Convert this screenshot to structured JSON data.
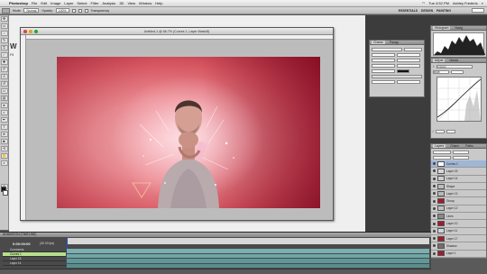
{
  "menubar": {
    "app_name": "Photoshop",
    "items": [
      "File",
      "Edit",
      "Image",
      "Layer",
      "Select",
      "Filter",
      "Analysis",
      "3D",
      "View",
      "Window",
      "Help"
    ],
    "clock": "Tue 4:52 PM",
    "user": "Ashley Frederic"
  },
  "options": {
    "mode_label": "Mode:",
    "mode_value": "Normal",
    "opacity_label": "Opacity:",
    "opacity_value": "100%",
    "transparency_label": "Transparency",
    "workspaces": [
      "ESSENTIALS",
      "DESIGN",
      "PAINTING"
    ]
  },
  "document": {
    "title": "Untitled-1 @ 66.7% (Curves 1, Layer Mask/8)"
  },
  "background_page": {
    "heading": "W",
    "sub": "Fil"
  },
  "panels": {
    "character_tabs": [
      "Charac",
      "Paragr"
    ],
    "histogram_tabs": [
      "Histogram",
      "Navig"
    ],
    "adjust_tabs": [
      "Adjust",
      "Masks"
    ],
    "adjust_preset": "Custom",
    "adjust_channel": "RGB",
    "layers_tabs": [
      "Layers",
      "Chann",
      "Paths"
    ],
    "layers": [
      {
        "name": "Curves 1",
        "color": "#ffffff",
        "selected": true
      },
      {
        "name": "Layer 15",
        "color": "#d8d8d8",
        "selected": false
      },
      {
        "name": "Layer 14",
        "color": "#cfcfcf",
        "selected": false
      },
      {
        "name": "Shape",
        "color": "#bdbdbd",
        "selected": false
      },
      {
        "name": "Layer 13",
        "color": "#b8b8b8",
        "selected": false
      },
      {
        "name": "Group",
        "color": "#a01c2c",
        "selected": false
      },
      {
        "name": "Layer 12",
        "color": "#c0c0c0",
        "selected": false
      },
      {
        "name": "Lines",
        "color": "#8a8a8a",
        "selected": false
      },
      {
        "name": "Layer 10",
        "color": "#a01c2c",
        "selected": false
      },
      {
        "name": "Layer 11",
        "color": "#d4d4d4",
        "selected": false
      },
      {
        "name": "Layer 17",
        "color": "#a01c2c",
        "selected": false
      },
      {
        "name": "Shadow",
        "color": "#707070",
        "selected": false
      },
      {
        "name": "Layer 1",
        "color": "#a01c2c",
        "selected": false
      }
    ]
  },
  "timeline": {
    "tab": "ANIMATION (TIMELINE)",
    "timecode": "0:00:00:00",
    "fps": "(30.00 fps)",
    "tracks": [
      "Comments",
      "Curves 1",
      "Layer 15",
      "Layer 14"
    ]
  }
}
